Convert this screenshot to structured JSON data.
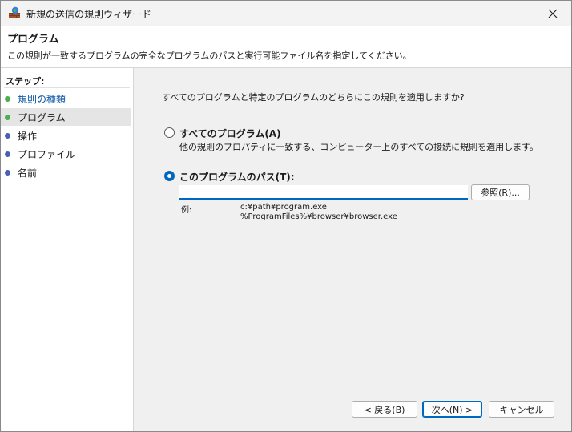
{
  "window": {
    "title": "新規の送信の規則ウィザード"
  },
  "header": {
    "title": "プログラム",
    "description": "この規則が一致するプログラムの完全なプログラムのパスと実行可能ファイル名を指定してください。"
  },
  "sidebar": {
    "steps_label": "ステップ:",
    "items": [
      {
        "label": "規則の種類",
        "dot_color": "#4caf50",
        "state": "completed"
      },
      {
        "label": "プログラム",
        "dot_color": "#4caf50",
        "state": "current"
      },
      {
        "label": "操作",
        "dot_color": "#4a5fb5",
        "state": "pending"
      },
      {
        "label": "プロファイル",
        "dot_color": "#4a5fb5",
        "state": "pending"
      },
      {
        "label": "名前",
        "dot_color": "#4a5fb5",
        "state": "pending"
      }
    ]
  },
  "main": {
    "question": "すべてのプログラムと特定のプログラムのどちらにこの規則を適用しますか?",
    "options": [
      {
        "label": "すべてのプログラム(A)",
        "description": "他の規則のプロパティに一致する、コンピューター上のすべての接続に規則を適用します。",
        "selected": false
      },
      {
        "label": "このプログラムのパス(T):",
        "selected": true
      }
    ],
    "path_value": "",
    "browse_label": "参照(R)...",
    "example_label": "例:",
    "example_lines": [
      "c:¥path¥program.exe",
      "%ProgramFiles%¥browser¥browser.exe"
    ]
  },
  "buttons": {
    "back": "< 戻る(B)",
    "next": "次へ(N) >",
    "cancel": "キャンセル"
  },
  "colors": {
    "accent": "#0067c0",
    "link": "#0b55a3",
    "completed_dot": "#4caf50",
    "pending_dot": "#4a5fb5"
  }
}
